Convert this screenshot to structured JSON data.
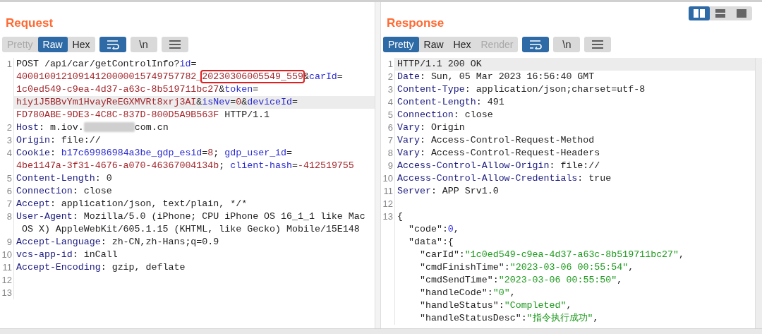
{
  "layout_buttons": [
    {
      "kind": "side-by-side",
      "selected": true
    },
    {
      "kind": "stacked",
      "selected": false
    },
    {
      "kind": "single",
      "selected": false
    }
  ],
  "panels": [
    {
      "title": "Request",
      "tabs": [
        {
          "label": "Pretty",
          "selected": false,
          "disabled": true
        },
        {
          "label": "Raw",
          "selected": true,
          "disabled": false
        },
        {
          "label": "Hex",
          "selected": false,
          "disabled": false
        }
      ],
      "tool_buttons": [
        {
          "kind": "wrap",
          "on": true
        },
        {
          "kind": "newline",
          "label": "\\n",
          "on": false
        },
        {
          "kind": "menu",
          "on": false
        }
      ],
      "lines": [
        {
          "number": "1",
          "rows": [
            {
              "current": false,
              "segments": [
                {
                  "kind": "plain",
                  "text": "POST /api/car/getControlInfo?"
                },
                {
                  "kind": "param",
                  "text": "id"
                },
                {
                  "kind": "plain",
                  "text": "="
                }
              ]
            },
            {
              "current": false,
              "segments": [
                {
                  "kind": "value",
                  "text": "40001001210914120000015749757782_"
                },
                {
                  "kind": "boxed",
                  "text": "20230306005549_559"
                },
                {
                  "kind": "plain",
                  "text": "&"
                },
                {
                  "kind": "param",
                  "text": "carId"
                },
                {
                  "kind": "plain",
                  "text": "="
                }
              ]
            },
            {
              "current": false,
              "segments": [
                {
                  "kind": "value",
                  "text": "1c0ed549-c9ea-4d37-a63c-8b519711bc27"
                },
                {
                  "kind": "plain",
                  "text": "&"
                },
                {
                  "kind": "param",
                  "text": "token"
                },
                {
                  "kind": "plain",
                  "text": "="
                }
              ]
            },
            {
              "current": true,
              "segments": [
                {
                  "kind": "value",
                  "text": "hiy1J5BBvYm1HvayReEGXMVRt8xrj3AI"
                },
                {
                  "kind": "plain",
                  "text": "&"
                },
                {
                  "kind": "param",
                  "text": "isNev"
                },
                {
                  "kind": "plain",
                  "text": "="
                },
                {
                  "kind": "value",
                  "text": "0"
                },
                {
                  "kind": "plain",
                  "text": "&"
                },
                {
                  "kind": "param",
                  "text": "deviceId"
                },
                {
                  "kind": "plain",
                  "text": "="
                }
              ]
            },
            {
              "current": false,
              "segments": [
                {
                  "kind": "value",
                  "text": "FD780ABE-9DE3-4C8C-837D-800D5A9B563F"
                },
                {
                  "kind": "plain",
                  "text": " HTTP/1.1"
                }
              ]
            }
          ]
        },
        {
          "number": "2",
          "rows": [
            {
              "current": false,
              "segments": [
                {
                  "kind": "name",
                  "text": "Host"
                },
                {
                  "kind": "plain",
                  "text": ": m.iov."
                },
                {
                  "kind": "redacted"
                },
                {
                  "kind": "plain",
                  "text": "com.cn"
                }
              ]
            }
          ]
        },
        {
          "number": "3",
          "rows": [
            {
              "current": false,
              "segments": [
                {
                  "kind": "name",
                  "text": "Origin"
                },
                {
                  "kind": "plain",
                  "text": ": file://"
                }
              ]
            }
          ]
        },
        {
          "number": "4",
          "rows": [
            {
              "current": false,
              "segments": [
                {
                  "kind": "name",
                  "text": "Cookie"
                },
                {
                  "kind": "plain",
                  "text": ": "
                },
                {
                  "kind": "param",
                  "text": "b17c69986984a3be_gdp_esid"
                },
                {
                  "kind": "plain",
                  "text": "="
                },
                {
                  "kind": "value",
                  "text": "8"
                },
                {
                  "kind": "plain",
                  "text": "; "
                },
                {
                  "kind": "param",
                  "text": "gdp_user_id"
                },
                {
                  "kind": "plain",
                  "text": "="
                }
              ]
            },
            {
              "current": false,
              "segments": [
                {
                  "kind": "value",
                  "text": "4be1147a-3f31-4676-a070-46367004134b"
                },
                {
                  "kind": "plain",
                  "text": "; "
                },
                {
                  "kind": "param",
                  "text": "client-hash"
                },
                {
                  "kind": "plain",
                  "text": "="
                },
                {
                  "kind": "value",
                  "text": "-412519755"
                }
              ]
            }
          ]
        },
        {
          "number": "5",
          "rows": [
            {
              "current": false,
              "segments": [
                {
                  "kind": "name",
                  "text": "Content-Length"
                },
                {
                  "kind": "plain",
                  "text": ": 0"
                }
              ]
            }
          ]
        },
        {
          "number": "6",
          "rows": [
            {
              "current": false,
              "segments": [
                {
                  "kind": "name",
                  "text": "Connection"
                },
                {
                  "kind": "plain",
                  "text": ": close"
                }
              ]
            }
          ]
        },
        {
          "number": "7",
          "rows": [
            {
              "current": false,
              "segments": [
                {
                  "kind": "name",
                  "text": "Accept"
                },
                {
                  "kind": "plain",
                  "text": ": application/json, text/plain, */*"
                }
              ]
            }
          ]
        },
        {
          "number": "8",
          "rows": [
            {
              "current": false,
              "segments": [
                {
                  "kind": "name",
                  "text": "User-Agent"
                },
                {
                  "kind": "plain",
                  "text": ": Mozilla/5.0 (iPhone; CPU iPhone OS 16_1_1 like Mac"
                }
              ]
            },
            {
              "current": false,
              "segments": [
                {
                  "kind": "plain",
                  "text": " OS X) AppleWebKit/605.1.15 (KHTML, like Gecko) Mobile/15E148"
                }
              ]
            }
          ]
        },
        {
          "number": "9",
          "rows": [
            {
              "current": false,
              "segments": [
                {
                  "kind": "name",
                  "text": "Accept-Language"
                },
                {
                  "kind": "plain",
                  "text": ": zh-CN,zh-Hans;q=0.9"
                }
              ]
            }
          ]
        },
        {
          "number": "10",
          "rows": [
            {
              "current": false,
              "segments": [
                {
                  "kind": "name",
                  "text": "vcs-app-id"
                },
                {
                  "kind": "plain",
                  "text": ": inCall"
                }
              ]
            }
          ]
        },
        {
          "number": "11",
          "rows": [
            {
              "current": false,
              "segments": [
                {
                  "kind": "name",
                  "text": "Accept-Encoding"
                },
                {
                  "kind": "plain",
                  "text": ": gzip, deflate"
                }
              ]
            }
          ]
        },
        {
          "number": "12",
          "rows": [
            {
              "current": false,
              "segments": []
            }
          ]
        },
        {
          "number": "13",
          "rows": [
            {
              "current": false,
              "segments": []
            }
          ]
        }
      ]
    },
    {
      "title": "Response",
      "tabs": [
        {
          "label": "Pretty",
          "selected": true,
          "disabled": false
        },
        {
          "label": "Raw",
          "selected": false,
          "disabled": false
        },
        {
          "label": "Hex",
          "selected": false,
          "disabled": false
        },
        {
          "label": "Render",
          "selected": false,
          "disabled": true
        }
      ],
      "tool_buttons": [
        {
          "kind": "wrap",
          "on": true
        },
        {
          "kind": "newline",
          "label": "\\n",
          "on": false
        },
        {
          "kind": "menu",
          "on": false
        }
      ],
      "lines": [
        {
          "number": "1",
          "rows": [
            {
              "current": true,
              "segments": [
                {
                  "kind": "plain",
                  "text": "HTTP/1.1 200 OK"
                }
              ]
            }
          ]
        },
        {
          "number": "2",
          "rows": [
            {
              "current": false,
              "segments": [
                {
                  "kind": "name",
                  "text": "Date"
                },
                {
                  "kind": "plain",
                  "text": ": Sun, 05 Mar 2023 16:56:40 GMT"
                }
              ]
            }
          ]
        },
        {
          "number": "3",
          "rows": [
            {
              "current": false,
              "segments": [
                {
                  "kind": "name",
                  "text": "Content-Type"
                },
                {
                  "kind": "plain",
                  "text": ": application/json;charset=utf-8"
                }
              ]
            }
          ]
        },
        {
          "number": "4",
          "rows": [
            {
              "current": false,
              "segments": [
                {
                  "kind": "name",
                  "text": "Content-Length"
                },
                {
                  "kind": "plain",
                  "text": ": 491"
                }
              ]
            }
          ]
        },
        {
          "number": "5",
          "rows": [
            {
              "current": false,
              "segments": [
                {
                  "kind": "name",
                  "text": "Connection"
                },
                {
                  "kind": "plain",
                  "text": ": close"
                }
              ]
            }
          ]
        },
        {
          "number": "6",
          "rows": [
            {
              "current": false,
              "segments": [
                {
                  "kind": "name",
                  "text": "Vary"
                },
                {
                  "kind": "plain",
                  "text": ": Origin"
                }
              ]
            }
          ]
        },
        {
          "number": "7",
          "rows": [
            {
              "current": false,
              "segments": [
                {
                  "kind": "name",
                  "text": "Vary"
                },
                {
                  "kind": "plain",
                  "text": ": Access-Control-Request-Method"
                }
              ]
            }
          ]
        },
        {
          "number": "8",
          "rows": [
            {
              "current": false,
              "segments": [
                {
                  "kind": "name",
                  "text": "Vary"
                },
                {
                  "kind": "plain",
                  "text": ": Access-Control-Request-Headers"
                }
              ]
            }
          ]
        },
        {
          "number": "9",
          "rows": [
            {
              "current": false,
              "segments": [
                {
                  "kind": "name",
                  "text": "Access-Control-Allow-Origin"
                },
                {
                  "kind": "plain",
                  "text": ": file://"
                }
              ]
            }
          ]
        },
        {
          "number": "10",
          "rows": [
            {
              "current": false,
              "segments": [
                {
                  "kind": "name",
                  "text": "Access-Control-Allow-Credentials"
                },
                {
                  "kind": "plain",
                  "text": ": true"
                }
              ]
            }
          ]
        },
        {
          "number": "11",
          "rows": [
            {
              "current": false,
              "segments": [
                {
                  "kind": "name",
                  "text": "Server"
                },
                {
                  "kind": "plain",
                  "text": ": APP Srv1.0"
                }
              ]
            }
          ]
        },
        {
          "number": "12",
          "rows": [
            {
              "current": false,
              "segments": []
            }
          ]
        },
        {
          "number": "13",
          "rows": [
            {
              "current": false,
              "segments": [
                {
                  "kind": "plain",
                  "text": "{"
                }
              ]
            }
          ],
          "children": [
            {
              "rows": [
                {
                  "current": false,
                  "segments": [
                    {
                      "kind": "jkey",
                      "text": "\"code\":"
                    },
                    {
                      "kind": "jnum",
                      "text": "0"
                    },
                    {
                      "kind": "plain",
                      "text": ","
                    }
                  ]
                }
              ]
            },
            {
              "rows": [
                {
                  "current": false,
                  "segments": [
                    {
                      "kind": "jkey",
                      "text": "\"data\":{"
                    }
                  ]
                }
              ],
              "children": [
                {
                  "rows": [
                    {
                      "current": false,
                      "segments": [
                        {
                          "kind": "jkey",
                          "text": "\"carId\":"
                        },
                        {
                          "kind": "jstr",
                          "text": "\"1c0ed549-c9ea-4d37-a63c-8b519711bc27\""
                        },
                        {
                          "kind": "plain",
                          "text": ","
                        }
                      ]
                    }
                  ]
                },
                {
                  "rows": [
                    {
                      "current": false,
                      "segments": [
                        {
                          "kind": "jkey",
                          "text": "\"cmdFinishTime\":"
                        },
                        {
                          "kind": "jstr",
                          "text": "\"2023-03-06 00:55:54\""
                        },
                        {
                          "kind": "plain",
                          "text": ","
                        }
                      ]
                    }
                  ]
                },
                {
                  "rows": [
                    {
                      "current": false,
                      "segments": [
                        {
                          "kind": "jkey",
                          "text": "\"cmdSendTime\":"
                        },
                        {
                          "kind": "jstr",
                          "text": "\"2023-03-06 00:55:50\""
                        },
                        {
                          "kind": "plain",
                          "text": ","
                        }
                      ]
                    }
                  ]
                },
                {
                  "rows": [
                    {
                      "current": false,
                      "segments": [
                        {
                          "kind": "jkey",
                          "text": "\"handleCode\":"
                        },
                        {
                          "kind": "jstr",
                          "text": "\"0\""
                        },
                        {
                          "kind": "plain",
                          "text": ","
                        }
                      ]
                    }
                  ]
                },
                {
                  "rows": [
                    {
                      "current": false,
                      "segments": [
                        {
                          "kind": "jkey",
                          "text": "\"handleStatus\":"
                        },
                        {
                          "kind": "jstr",
                          "text": "\"Completed\""
                        },
                        {
                          "kind": "plain",
                          "text": ","
                        }
                      ]
                    }
                  ]
                },
                {
                  "rows": [
                    {
                      "current": false,
                      "segments": [
                        {
                          "kind": "jkey",
                          "text": "\"handleStatusDesc\":"
                        },
                        {
                          "kind": "jstr",
                          "text": "\"指令执行成功\""
                        },
                        {
                          "kind": "plain",
                          "text": ","
                        }
                      ]
                    }
                  ]
                }
              ]
            }
          ]
        }
      ]
    }
  ]
}
